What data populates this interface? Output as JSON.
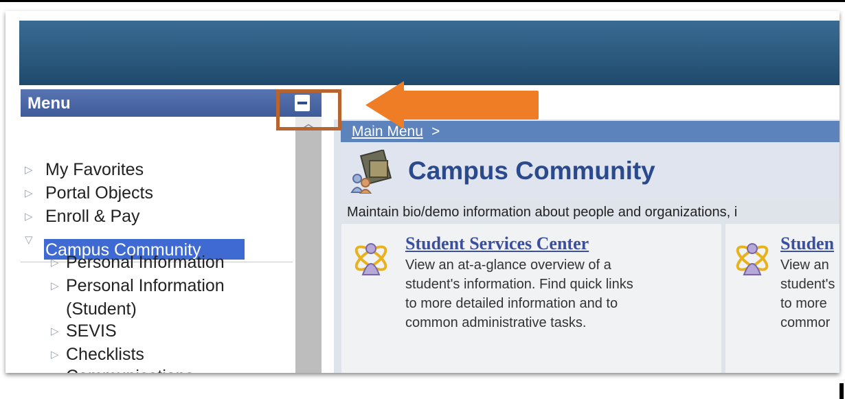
{
  "menu": {
    "title": "Menu",
    "items": [
      {
        "label": "My Favorites"
      },
      {
        "label": "Portal Objects"
      },
      {
        "label": "Enroll & Pay"
      },
      {
        "label": "Campus Community"
      }
    ],
    "sub_items": [
      {
        "label": "Personal Information"
      },
      {
        "label": "Personal Information"
      },
      {
        "label": "(Student)"
      },
      {
        "label": "SEVIS"
      },
      {
        "label": "Checklists"
      },
      {
        "label": "Communications"
      }
    ]
  },
  "breadcrumb": {
    "link": "Main Menu",
    "separator": ">"
  },
  "page": {
    "title": "Campus Community",
    "description": "Maintain bio/demo information about people and organizations, i"
  },
  "cards": [
    {
      "title": "Student Services Center",
      "lines": [
        "View an at-a-glance overview of a",
        "student's information. Find quick links",
        "to more detailed information and to",
        "common administrative tasks."
      ]
    },
    {
      "title": "Studen",
      "lines": [
        "View an",
        "student's",
        "to more",
        "commor"
      ]
    }
  ],
  "colors": {
    "banner": "#1f4a6c",
    "menu_header": "#4a66a6",
    "selection": "#3f6ad1",
    "annotation": "#ef7d26",
    "title_text": "#2a4a8c"
  }
}
